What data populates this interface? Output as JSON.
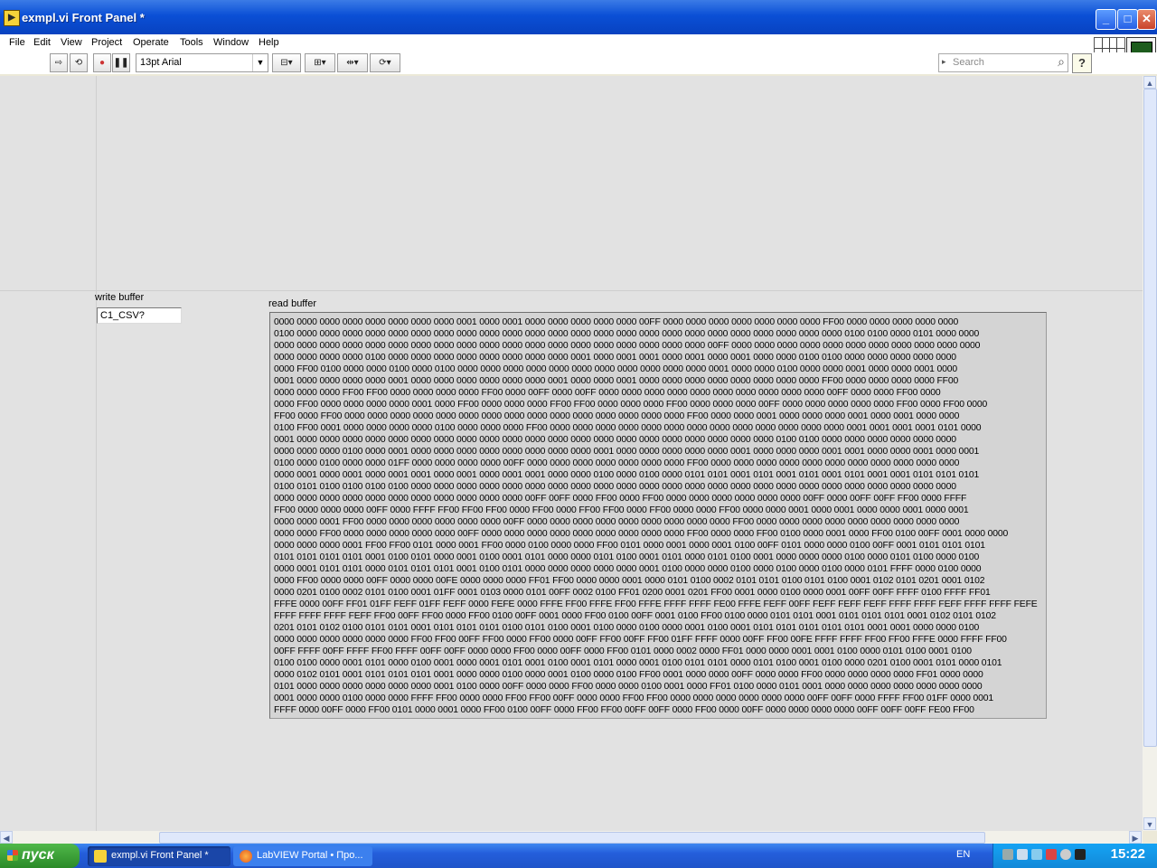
{
  "window": {
    "title": "exmpl.vi Front Panel *"
  },
  "menu": [
    "File",
    "Edit",
    "View",
    "Project",
    "Operate",
    "Tools",
    "Window",
    "Help"
  ],
  "toolbar": {
    "font": "13pt Arial",
    "search_placeholder": "Search",
    "help": "?"
  },
  "vi_icon_number": "1",
  "write_buffer": {
    "label": "write buffer",
    "value": "C1_CSV?"
  },
  "read_buffer": {
    "label": "read buffer",
    "lines": [
      "0000 0000 0000 0000 0000 0000 0000 0000 0001 0000 0001 0000 0000 0000 0000 0000 00FF 0000 0000 0000 0000 0000 0000 0000 FF00 0000 0000 0000 0000 0000",
      "0100 0000 0000 0000 0000 0000 0000 0000 0000 0000 0000 0000 0000 0000 0000 0000 0000 0000 0000 0000 0000 0000 0000 0000 0000 0100 0100 0000 0101 0000 0000",
      "0000 0000 0000 0000 0000 0000 0000 0000 0000 0000 0000 0000 0000 0000 0000 0000 0000 0000 0000 00FF 0000 0000 0000 0000 0000 0000 0000 0000 0000 0000 0000",
      "0000 0000 0000 0000 0100 0000 0000 0000 0000 0000 0000 0000 0000 0001 0000 0001 0001 0000 0001 0000 0001 0000 0000 0100 0100 0000 0000 0000 0000 0000",
      "0000 FF00 0100 0000 0000 0100 0000 0100 0000 0000 0000 0000 0000 0000 0000 0000 0000 0000 0000 0001 0000 0000 0100 0000 0000 0001 0000 0000 0001 0000",
      "0001 0000 0000 0000 0000 0001 0000 0000 0000 0000 0000 0000 0001 0000 0000 0001 0000 0000 0000 0000 0000 0000 0000 0000 FF00 0000 0000 0000 0000 FF00",
      "0000 0000 0000 FF00 FF00 0000 0000 0000 0000 FF00 0000 00FF 0000 00FF 0000 0000 0000 0000 0000 0000 0000 0000 0000 0000 00FF 0000 0000 FF00 0000",
      "0000 FF00 0000 0000 0000 0000 0001 0000 FF00 0000 0000 0000 FF00 FF00 0000 0000 0000 FF00 0000 0000 0000 00FF 0000 0000 0000 0000 0000 FF00 0000 FF00 0000",
      "FF00 0000 FF00 0000 0000 0000 0000 0000 0000 0000 0000 0000 0000 0000 0000 0000 0000 0000 FF00 0000 0000 0001 0000 0000 0000 0001 0000 0001 0000 0000",
      "0100 FF00 0001 0000 0000 0000 0000 0100 0000 0000 0000 FF00 0000 0000 0000 0000 0000 0000 0000 0000 0000 0000 0000 0000 0000 0001 0001 0001 0001 0101 0000",
      "0001 0000 0000 0000 0000 0000 0000 0000 0000 0000 0000 0000 0000 0000 0000 0000 0000 0000 0000 0000 0000 0000 0100 0100 0000 0000 0000 0000 0000 0000",
      "0000 0000 0000 0100 0000 0001 0000 0000 0000 0000 0000 0000 0000 0000 0001 0000 0000 0000 0000 0000 0001 0000 0000 0000 0001 0001 0000 0000 0001 0000 0001",
      "0100 0000 0100 0000 0000 01FF 0000 0000 0000 0000 00FF 0000 0000 0000 0000 0000 0000 0000 FF00 0000 0000 0000 0000 0000 0000 0000 0000 0000 0000 0000",
      "0000 0001 0000 0001 0000 0001 0001 0000 0001 0000 0001 0001 0000 0000 0100 0000 0100 0000 0101 0101 0001 0101 0001 0101 0001 0101 0001 0001 0101 0101 0101",
      "0100 0101 0100 0100 0100 0100 0000 0000 0000 0000 0000 0000 0000 0000 0000 0000 0000 0000 0000 0000 0000 0000 0000 0000 0000 0000 0000 0000 0000 0000",
      "0000 0000 0000 0000 0000 0000 0000 0000 0000 0000 0000 00FF 00FF 0000 FF00 0000 FF00 0000 0000 0000 0000 0000 0000 00FF 0000 00FF 00FF FF00 0000 FFFF",
      "FF00 0000 0000 0000 00FF 0000 FFFF FF00 FF00 FF00 0000 FF00 0000 FF00 FF00 0000 FF00 0000 0000 FF00 0000 0000 0001 0000 0001 0000 0000 0001 0000 0001",
      "0000 0000 0001 FF00 0000 0000 0000 0000 0000 0000 00FF 0000 0000 0000 0000 0000 0000 0000 0000 0000 FF00 0000 0000 0000 0000 0000 0000 0000 0000 0000",
      "0000 0000 FF00 0000 0000 0000 0000 0000 00FF 0000 0000 0000 0000 0000 0000 0000 0000 0000 FF00 0000 0000 FF00 0100 0000 0001 0000 FF00 0100 00FF 0001 0000 0000",
      "0000 0000 0000 0001 FF00 FF00 0101 0000 0001 FF00 0000 0100 0000 0000 FF00 0101 0000 0001 0000 0001 0100 00FF 0101 0000 0000 0100 00FF 0001 0101 0101 0101",
      "0101 0101 0101 0101 0001 0100 0101 0000 0001 0100 0001 0101 0000 0000 0101 0100 0001 0101 0000 0101 0100 0001 0000 0000 0000 0100 0000 0101 0100 0000 0100",
      "0000 0001 0101 0101 0000 0101 0101 0101 0001 0100 0101 0000 0000 0000 0000 0000 0001 0100 0000 0000 0100 0000 0100 0000 0100 0000 0101 FFFF 0000 0100 0000",
      "0000 FF00 0000 0000 00FF 0000 0000 00FE 0000 0000 0000 FF01 FF00 0000 0000 0001 0000 0101 0100 0002 0101 0101 0100 0101 0100 0001 0102 0101 0201 0001 0102",
      "0000 0201 0100 0002 0101 0100 0001 01FF 0001 0103 0000 0101 00FF 0002 0100 FF01 0200 0001 0201 FF00 0001 0000 0100 0000 0001 00FF 00FF FFFF 0100 FFFF FF01",
      "FFFE 0000 00FF FF01 01FF FEFF 01FF FEFF 0000 FEFE 0000 FFFE FF00 FFFE FF00 FFFE FFFF FFFF FE00 FFFE FEFF 00FF FEFF FEFF FEFF FFFF FFFF FEFF FFFF FFFF FEFE",
      "FFFF FFFF FFFF FEFF FF00 00FF FF00 0000 FF00 0100 00FF 0001 0000 FF00 0100 00FF 0001 0100 FF00 0100 0000 0101 0101 0001 0101 0101 0101 0001 0102 0101 0102",
      "0201 0101 0102 0100 0101 0101 0001 0101 0101 0101 0100 0101 0100 0001 0100 0000 0100 0000 0001 0100 0001 0101 0101 0101 0101 0101 0001 0001 0000 0000 0100",
      "0000 0000 0000 0000 0000 0000 FF00 FF00 00FF FF00 0000 FF00 0000 00FF FF00 00FF FF00 01FF FFFF 0000 00FF FF00 00FE FFFF FFFF FF00 FF00 FFFE 0000 FFFF FF00",
      "00FF FFFF 00FF FFFF FF00 FFFF 00FF 00FF 0000 0000 FF00 0000 00FF 0000 FF00 0101 0000 0002 0000 FF01 0000 0000 0001 0001 0100 0000 0101 0100 0001 0100",
      "0100 0100 0000 0001 0101 0000 0100 0001 0000 0001 0101 0001 0100 0001 0101 0000 0001 0100 0101 0101 0000 0101 0100 0001 0100 0000 0201 0100 0001 0101 0000 0101",
      "0000 0102 0101 0001 0101 0101 0101 0001 0000 0000 0100 0000 0001 0100 0000 0100 FF00 0001 0000 0000 00FF 0000 0000 FF00 0000 0000 0000 0000 FF01 0000 0000",
      "0101 0000 0000 0000 0000 0000 0000 0001 0100 0000 00FF 0000 0000 FF00 0000 0000 0100 0001 0000 FF01 0100 0000 0101 0001 0000 0000 0000 0000 0000 0000 0000",
      "0001 0000 0000 0100 0000 0000 FFFF FF00 0000 0000 FF00 FF00 00FF 0000 0000 FF00 FF00 0000 0000 0000 0000 0000 0000 00FF 00FF 0000 FFFF FF00 01FF 0000 0001",
      "FFFF 0000 00FF 0000 FF00 0101 0000 0001 0000 FF00 0100 00FF 0000 FF00 FF00 00FF 00FF 0000 FF00 0000 00FF 0000 0000 0000 0000 00FF 00FF 00FF FE00 FF00"
    ]
  },
  "taskbar": {
    "start": "пуск",
    "items": [
      "exmpl.vi Front Panel *",
      "LabVIEW Portal • Про..."
    ],
    "lang": "EN",
    "clock": "15:22"
  }
}
